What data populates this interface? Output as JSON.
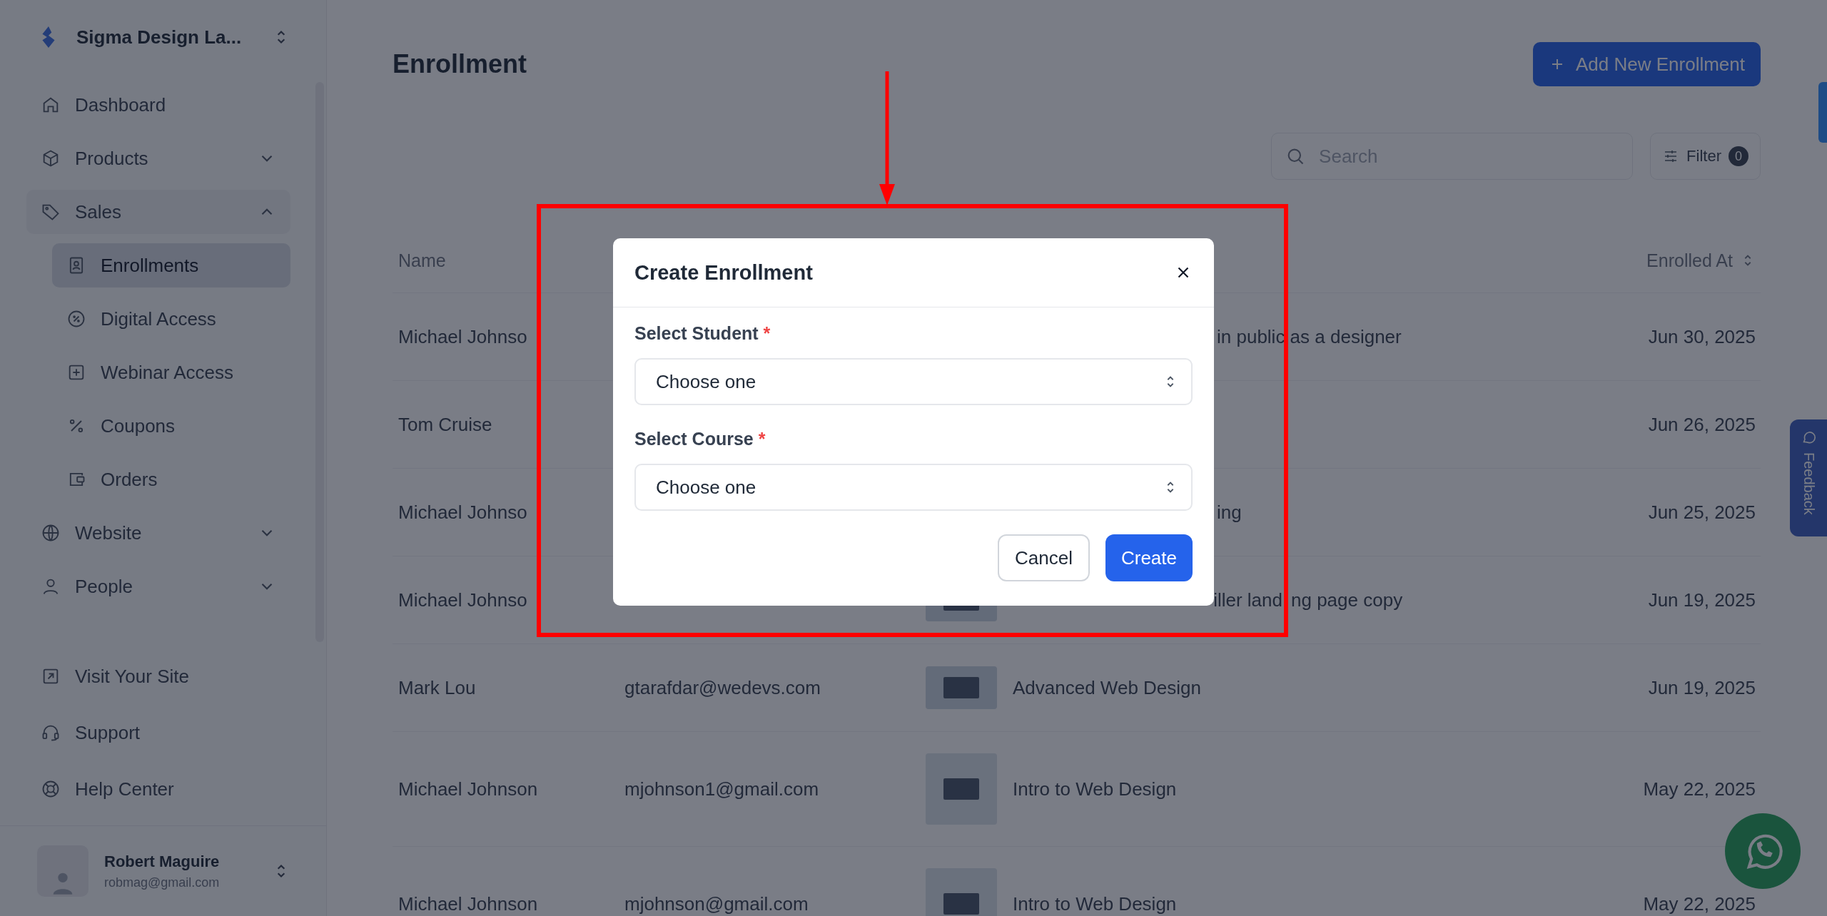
{
  "sidebar": {
    "org_name": "Sigma Design La...",
    "items": [
      {
        "label": "Dashboard",
        "selected": false
      },
      {
        "label": "Products",
        "selected": false,
        "expanded": false
      },
      {
        "label": "Sales",
        "selected": false,
        "expanded": true,
        "children": [
          {
            "label": "Enrollments",
            "selected": true
          },
          {
            "label": "Digital Access",
            "selected": false
          },
          {
            "label": "Webinar Access",
            "selected": false
          },
          {
            "label": "Coupons",
            "selected": false
          },
          {
            "label": "Orders",
            "selected": false
          }
        ]
      },
      {
        "label": "Website",
        "selected": false,
        "expanded": false
      },
      {
        "label": "People",
        "selected": false,
        "expanded": false
      }
    ],
    "footer_links": [
      "Visit Your Site",
      "Support",
      "Help Center"
    ],
    "user": {
      "name": "Robert Maguire",
      "email": "robmag@gmail.com"
    }
  },
  "page": {
    "title": "Enrollment",
    "add_button": "Add New Enrollment",
    "search": {
      "placeholder": "Search"
    },
    "filter": {
      "label": "Filter",
      "count": "0"
    }
  },
  "table": {
    "columns": [
      {
        "label": "Name",
        "sortable": false
      },
      {
        "label": "Enrolled At",
        "sortable": true
      }
    ],
    "rows": [
      {
        "kind": "plain",
        "name": "Michael Johnso",
        "course": "in public as a designer",
        "covered": true,
        "date": "Jun 30, 2025"
      },
      {
        "kind": "plain",
        "name": "Tom Cruise",
        "date": "Jun 26, 2025"
      },
      {
        "kind": "plain",
        "name": "Michael Johnso",
        "course": "ing",
        "covered": true,
        "date": "Jun 25, 2025"
      },
      {
        "kind": "wide",
        "name": "Michael Johnso",
        "course": "iller land",
        "course_tail": "ng page copy",
        "covered": true,
        "date": "Jun 19, 2025"
      },
      {
        "kind": "wide",
        "name": "Mark Lou",
        "email": "gtarafdar@wedevs.com",
        "course": "Advanced Web Design",
        "date": "Jun 19, 2025"
      },
      {
        "kind": "square",
        "name": "Michael Johnson",
        "email": "mjohnson1@gmail.com",
        "course": "Intro to Web Design",
        "date": "May 22, 2025"
      },
      {
        "kind": "square",
        "name": "Michael Johnson",
        "email": "mjohnson@gmail.com",
        "course": "Intro to Web Design",
        "date": "May 22, 2025"
      }
    ]
  },
  "feedback_tab": "Feedback",
  "modal": {
    "title": "Create Enrollment",
    "fields": [
      {
        "label": "Select Student",
        "required_mark": "*",
        "placeholder": "Choose one"
      },
      {
        "label": "Select Course",
        "required_mark": "*",
        "placeholder": "Choose one"
      }
    ],
    "buttons": [
      {
        "label": "Cancel",
        "kind": "secondary"
      },
      {
        "label": "Create",
        "kind": "primary"
      }
    ]
  }
}
